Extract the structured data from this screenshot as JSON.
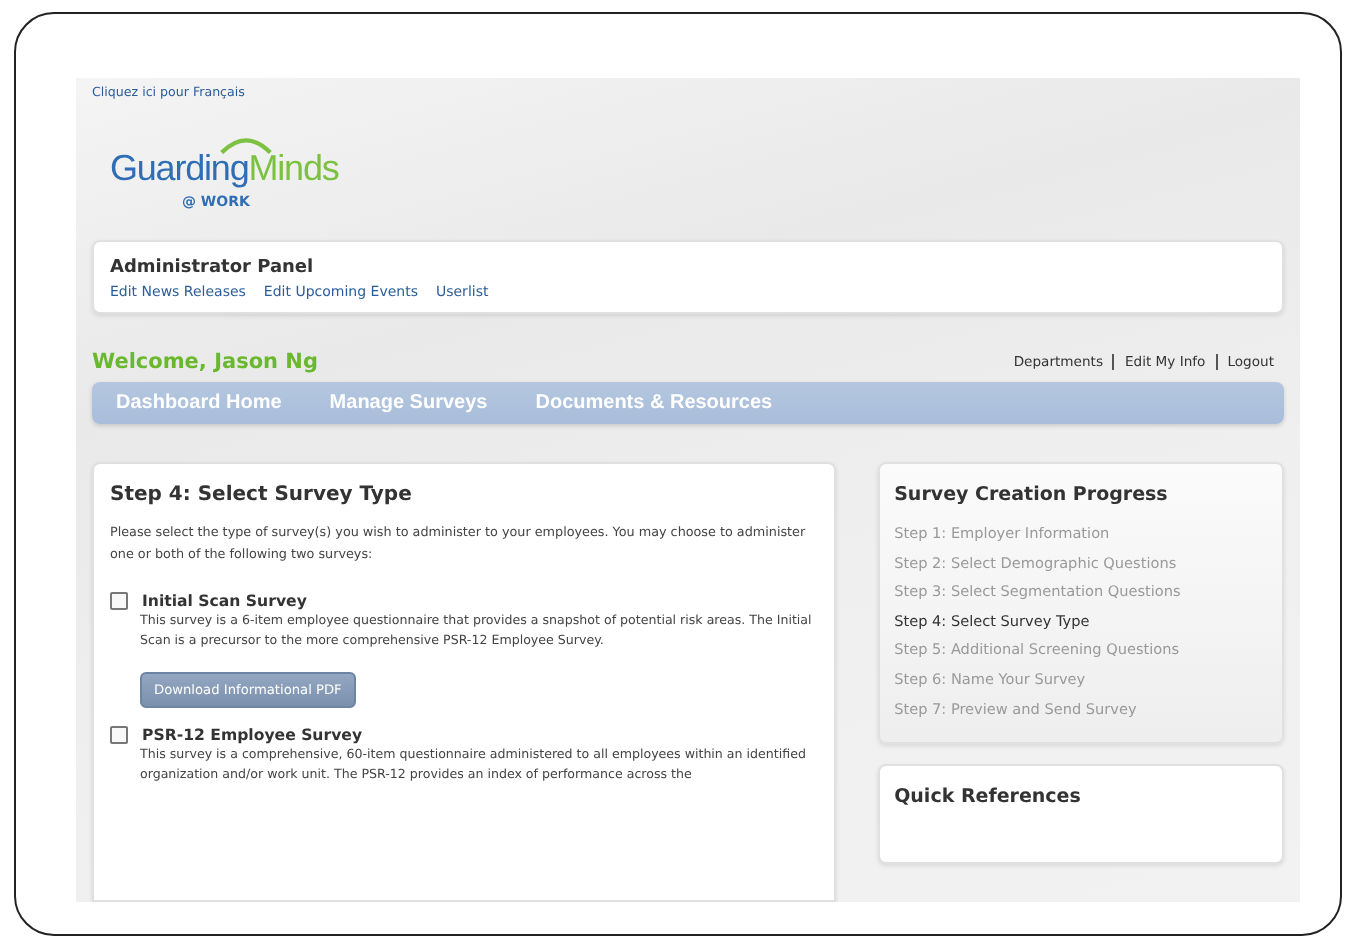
{
  "language_link": "Cliquez ici pour Français",
  "logo": {
    "wordmark_left": "Guarding",
    "wordmark_right": "Minds",
    "tagline": "@ WORK"
  },
  "admin_panel": {
    "title": "Administrator Panel",
    "links": [
      "Edit News Releases",
      "Edit Upcoming Events",
      "Userlist"
    ]
  },
  "welcome": "Welcome, Jason Ng",
  "user_links": [
    "Departments",
    "Edit My Info",
    "Logout"
  ],
  "nav": [
    "Dashboard Home",
    "Manage Surveys",
    "Documents & Resources"
  ],
  "main": {
    "title": "Step 4: Select Survey Type",
    "intro": "Please select the type of survey(s) you wish to administer to your employees. You may choose to administer one or both of the following two surveys:",
    "surveys": [
      {
        "name": "Initial Scan Survey",
        "checked": false,
        "description": "This survey is a 6-item employee questionnaire that provides a snapshot of potential risk areas. The Initial Scan is a precursor to the more comprehensive PSR-12 Employee Survey.",
        "button": "Download Informational PDF"
      },
      {
        "name": "PSR-12 Employee Survey",
        "checked": false,
        "description": "This survey is a comprehensive, 60-item questionnaire administered to all employees within an identified organization and/or work unit. The PSR-12 provides an index of performance across the"
      }
    ]
  },
  "progress": {
    "title": "Survey Creation Progress",
    "steps": [
      {
        "label": "Step 1: Employer Information",
        "selected": false
      },
      {
        "label": "Step 2: Select Demographic Questions",
        "selected": false
      },
      {
        "label": "Step 3: Select Segmentation Questions",
        "selected": false
      },
      {
        "label": "Step 4: Select Survey Type",
        "selected": true
      },
      {
        "label": "Step 5: Additional Screening Questions",
        "selected": false
      },
      {
        "label": "Step 6: Name Your Survey",
        "selected": false
      },
      {
        "label": "Step 7: Preview and Send Survey",
        "selected": false
      }
    ]
  },
  "quick_references": {
    "title": "Quick References"
  }
}
